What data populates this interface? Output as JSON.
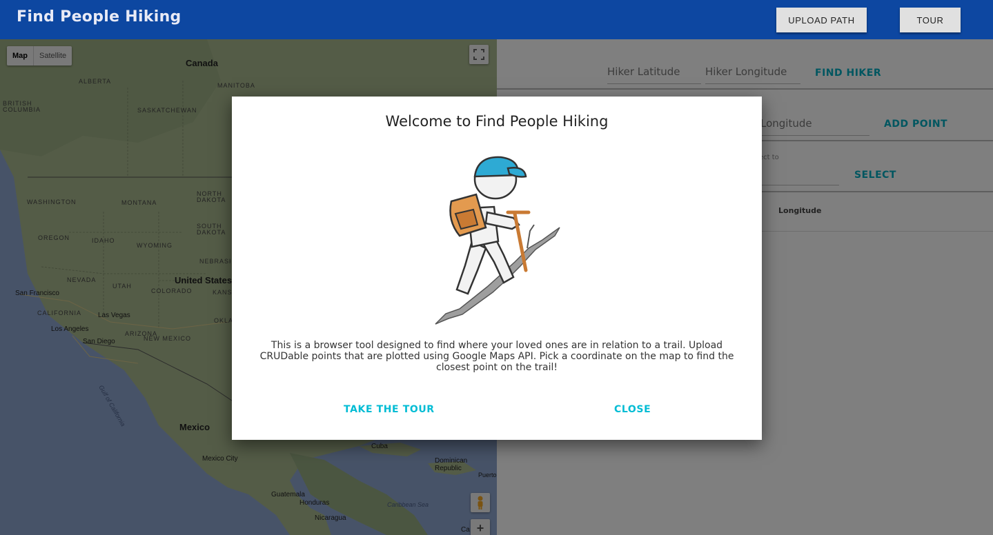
{
  "header": {
    "title": "Find People Hiking",
    "upload_path": "UPLOAD PATH",
    "tour": "TOUR",
    "bg_color": "#0d47a1"
  },
  "map": {
    "type_controls": [
      "Map",
      "Satellite"
    ],
    "countries": [
      "Canada",
      "United States",
      "Mexico",
      "Cuba"
    ],
    "states": [
      "ALBERTA",
      "BRITISH COLUMBIA",
      "MANITOBA",
      "SASKATCHEWAN",
      "WASHINGTON",
      "MONTANA",
      "NORTH DAKOTA",
      "SOUTH DAKOTA",
      "OREGON",
      "IDAHO",
      "WYOMING",
      "NEBRASKA",
      "NEVADA",
      "UTAH",
      "COLORADO",
      "KANSAS",
      "CALIFORNIA",
      "ARIZONA",
      "NEW MEXICO",
      "OKLA"
    ],
    "cities": [
      "San Francisco",
      "Las Vegas",
      "Los Angeles",
      "San Diego",
      "Mexico City",
      "Guatemala",
      "Honduras",
      "Nicaragua",
      "Dominican Republic",
      "Puerto",
      "Ca"
    ],
    "water": [
      "Gulf of California",
      "Caribbean Sea"
    ],
    "zoom_in": "+"
  },
  "panel": {
    "hiker_latitude_placeholder": "Hiker Latitude",
    "hiker_longitude_placeholder": "Hiker Longitude",
    "find_hiker": "FIND HIKER",
    "point_longitude_placeholder": "Longitude",
    "add_point": "ADD POINT",
    "select_to_label": "ect to",
    "select": "SELECT",
    "column_longitude": "Longitude"
  },
  "modal": {
    "title": "Welcome to Find People Hiking",
    "description": "This is a browser tool designed to find where your loved ones are in relation to a trail. Upload CRUDable points that are plotted using Google Maps API. Pick a coordinate on the map to find the closest point on the trail!",
    "take_tour": "TAKE THE TOUR",
    "close": "CLOSE",
    "accent_color": "#00bcd4"
  }
}
